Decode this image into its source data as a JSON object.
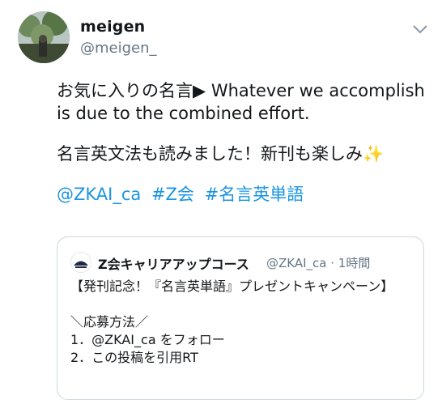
{
  "tweet": {
    "author_name": "meigen",
    "author_handle": "@meigen_",
    "text_line1": "お気に入りの名言▶ Whatever we accomplish",
    "text_line2": "is due to the combined effort.",
    "text_line3": "名言英文法も読みました！新刊も楽しみ✨",
    "mentions": [
      "@ZKAI_ca",
      "#Z会",
      "#名言英単語"
    ]
  },
  "quoted_tweet": {
    "author_name": "Z会キャリアアップコース",
    "meta": "@ZKAI_ca · 1時間",
    "line1": "【発刊記念！『名言英単語』プレゼントキャンペーン】",
    "line2": "＼応募方法／",
    "line3": "1．@ZKAI_ca をフォロー",
    "line4": "2．この投稿を引用RT"
  },
  "icons": {
    "menu": "chevron-down-icon",
    "avatar": "profile-photo",
    "quoted_avatar": "zkai-logo"
  },
  "colors": {
    "link": "#1b95e0",
    "secondary_text": "#657786",
    "border": "#ccd6dd"
  }
}
